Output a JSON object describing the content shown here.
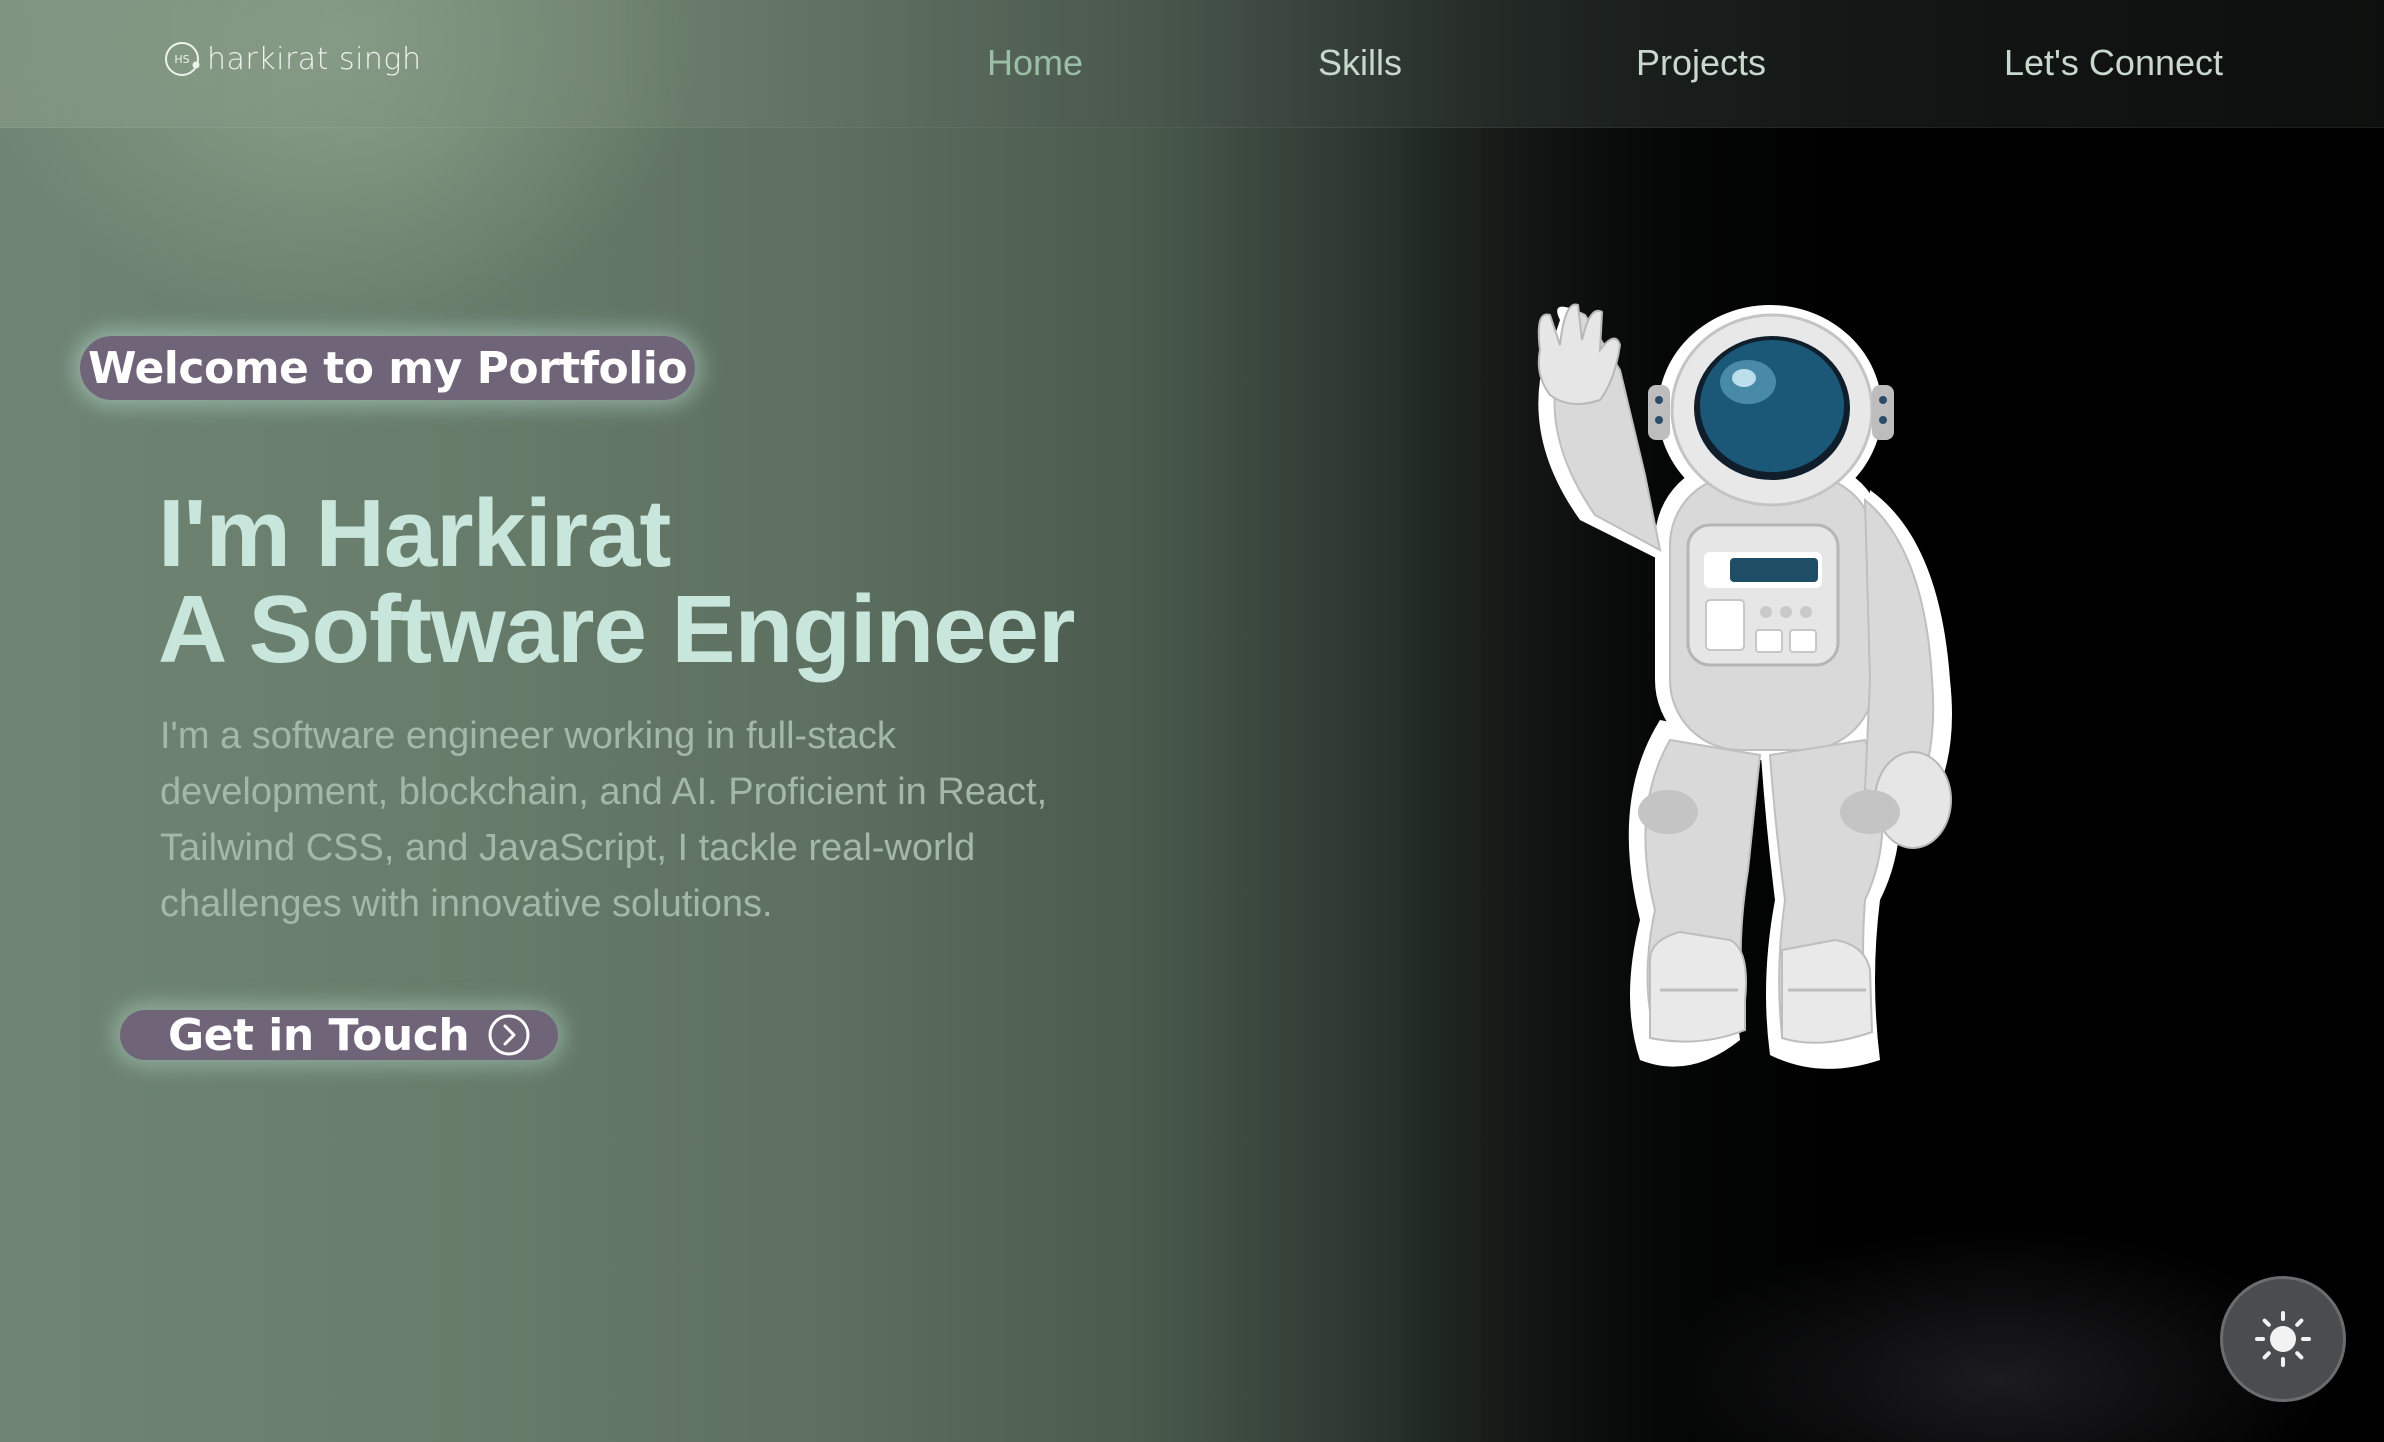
{
  "nav": {
    "logo_text": "harkirat singh",
    "logo_initials": "HS",
    "links": [
      {
        "label": "Home",
        "active": true
      },
      {
        "label": "Skills",
        "active": false
      },
      {
        "label": "Projects",
        "active": false
      },
      {
        "label": "Let's Connect",
        "active": false
      }
    ]
  },
  "hero": {
    "badge": "Welcome to my Portfolio",
    "title_line1": "I'm Harkirat",
    "title_line2": "A Software Engineer",
    "description": "I'm a software engineer working in full-stack development, blockchain, and AI. Proficient in React, Tailwind CSS, and JavaScript, I tackle real-world challenges with innovative solutions.",
    "cta_label": "Get in Touch",
    "cta_icon": "chevron-circle-right-icon",
    "illustration": "astronaut-waving"
  },
  "theme_toggle": {
    "icon": "sun-icon"
  },
  "colors": {
    "accent_text": "#c8e6dc",
    "badge_bg": "#6f6478",
    "nav_active": "#9bbfa6"
  }
}
